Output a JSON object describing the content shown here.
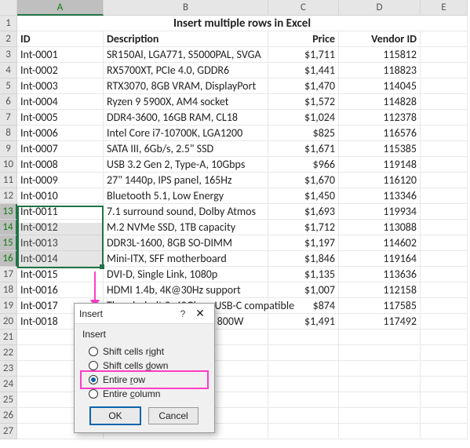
{
  "columns": [
    "A",
    "B",
    "C",
    "D",
    "E"
  ],
  "title": "Insert multiple rows in Excel",
  "headers": {
    "id": "ID",
    "desc": "Description",
    "price": "Price",
    "vendor": "Vendor ID"
  },
  "rows": [
    {
      "n": 1
    },
    {
      "n": 2
    },
    {
      "n": 3,
      "id": "Int-0001",
      "desc": "SR150Al, LGA771, S5000PAL, SVGA",
      "price": "$1,711",
      "vendor": "115812"
    },
    {
      "n": 4,
      "id": "Int-0002",
      "desc": "RX5700XT, PCIe 4.0, GDDR6",
      "price": "$1,441",
      "vendor": "118823"
    },
    {
      "n": 5,
      "id": "Int-0003",
      "desc": "RTX3070, 8GB VRAM, DisplayPort",
      "price": "$1,470",
      "vendor": "114045"
    },
    {
      "n": 6,
      "id": "Int-0004",
      "desc": "Ryzen 9 5900X, AM4 socket",
      "price": "$1,572",
      "vendor": "114828"
    },
    {
      "n": 7,
      "id": "Int-0005",
      "desc": "DDR4-3600, 16GB RAM, CL18",
      "price": "$1,024",
      "vendor": "112378"
    },
    {
      "n": 8,
      "id": "Int-0006",
      "desc": "Intel Core i7-10700K, LGA1200",
      "price": "$825",
      "vendor": "116576"
    },
    {
      "n": 9,
      "id": "Int-0007",
      "desc": "SATA III, 6Gb/s, 2.5\" SSD",
      "price": "$1,671",
      "vendor": "115385"
    },
    {
      "n": 10,
      "id": "Int-0008",
      "desc": "USB 3.2 Gen 2, Type-A, 10Gbps",
      "price": "$966",
      "vendor": "119148"
    },
    {
      "n": 11,
      "id": "Int-0009",
      "desc": "27\" 1440p, IPS panel, 165Hz",
      "price": "$1,670",
      "vendor": "116120"
    },
    {
      "n": 12,
      "id": "Int-0010",
      "desc": "Bluetooth 5.1, Low Energy",
      "price": "$1,450",
      "vendor": "113346"
    },
    {
      "n": 13,
      "id": "Int-0011",
      "desc": "7.1 surround sound, Dolby Atmos",
      "price": "$1,693",
      "vendor": "119934"
    },
    {
      "n": 14,
      "id": "Int-0012",
      "desc": "M.2 NVMe SSD, 1TB capacity",
      "price": "$1,712",
      "vendor": "113088"
    },
    {
      "n": 15,
      "id": "Int-0013",
      "desc": "DDR3L-1600, 8GB SO-DIMM",
      "price": "$1,197",
      "vendor": "114602"
    },
    {
      "n": 16,
      "id": "Int-0014",
      "desc": "Mini-ITX, SFF motherboard",
      "price": "$1,846",
      "vendor": "119164"
    },
    {
      "n": 17,
      "id": "Int-0015",
      "desc": "DVI-D, Single Link, 1080p",
      "price": "$1,135",
      "vendor": "113636"
    },
    {
      "n": 18,
      "id": "Int-0016",
      "desc": "HDMI 1.4b, 4K@30Hz support",
      "price": "$1,007",
      "vendor": "112158"
    },
    {
      "n": 19,
      "id": "Int-0017",
      "desc": "Thunderbolt 3, 40Gbps, USB-C compatible",
      "price": "$874",
      "vendor": "117585"
    },
    {
      "n": 20,
      "id": "Int-0018",
      "desc": "Power Supply, 80+ Gold, 800W",
      "price": "$1,491",
      "vendor": "117492"
    },
    {
      "n": 21
    },
    {
      "n": 22
    },
    {
      "n": 23
    },
    {
      "n": 24
    },
    {
      "n": 25
    },
    {
      "n": 26
    },
    {
      "n": 27
    }
  ],
  "dialog": {
    "title": "Insert",
    "group": "Insert",
    "opt1": "Shift cells right",
    "opt2": "Shift cells down",
    "opt3": "Entire row",
    "opt4": "Entire column",
    "selected": "opt3",
    "ok": "OK",
    "cancel": "Cancel"
  }
}
